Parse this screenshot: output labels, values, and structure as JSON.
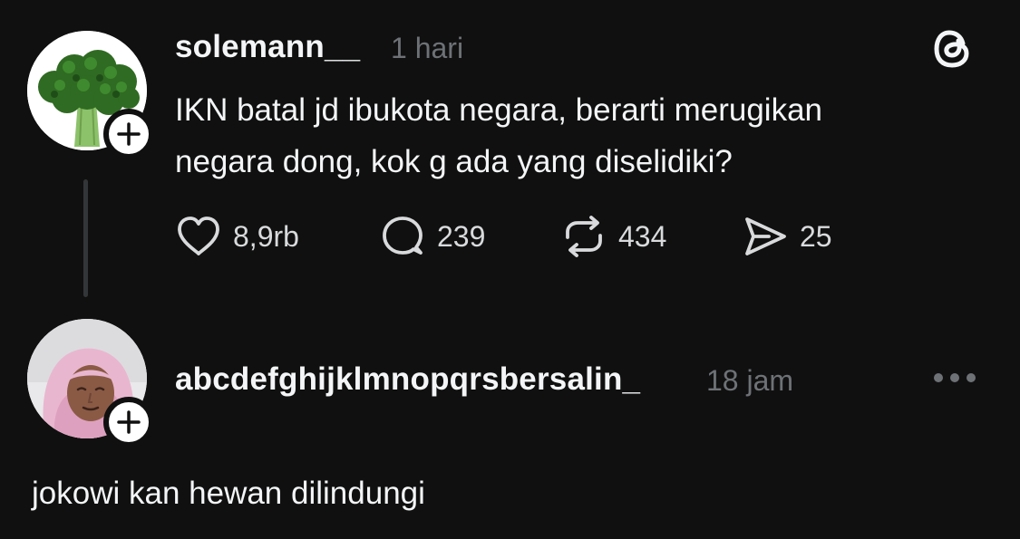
{
  "post": {
    "username": "solemann__",
    "time": "1 hari",
    "text_line1": "IKN batal jd ibukota negara, berarti merugikan",
    "text_line2": "negara dong, kok g ada yang diselidiki?",
    "avatar_icon": "broccoli-avatar",
    "actions": {
      "likes": "8,9rb",
      "replies": "239",
      "reposts": "434",
      "shares": "25"
    }
  },
  "reply": {
    "username": "abcdefghijklmnopqrsbersalin_",
    "time": "18 jam",
    "text": "jokowi kan hewan dilindungi",
    "avatar_icon": "person-in-hijab-avatar"
  },
  "icons": {
    "app_logo": "threads-logo-icon",
    "like": "heart-icon",
    "reply": "speech-bubble-icon",
    "repost": "repost-icon",
    "share": "send-icon",
    "follow": "plus-icon",
    "more": "more-dots-icon"
  },
  "colors": {
    "background": "#101010",
    "text_primary": "#f3f5f7",
    "text_secondary": "#6e7276",
    "thread_line": "#333638"
  }
}
